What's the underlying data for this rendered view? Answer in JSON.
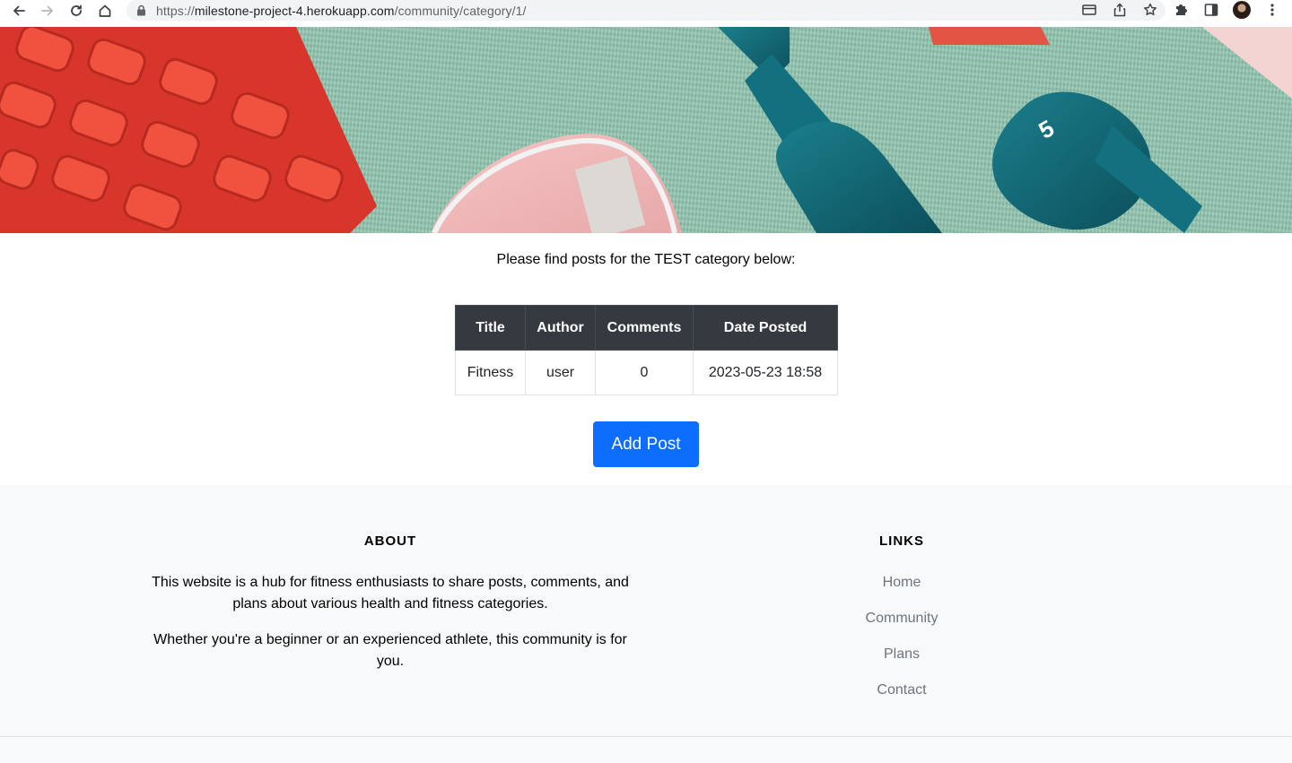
{
  "browser": {
    "url_scheme": "https://",
    "url_host": "milestone-project-4.herokuapp.com",
    "url_path": "/community/category/1/"
  },
  "hero": {
    "dumbbell_label": "5"
  },
  "intro_text": "Please find posts for the TEST category below:",
  "table": {
    "headers": [
      "Title",
      "Author",
      "Comments",
      "Date Posted"
    ],
    "rows": [
      [
        "Fitness",
        "user",
        "0",
        "2023-05-23 18:58"
      ]
    ]
  },
  "add_post_label": "Add Post",
  "footer": {
    "about_heading": "ABOUT",
    "about_p1": "This website is a hub for fitness enthusiasts to share posts, comments, and plans about various health and fitness categories.",
    "about_p2": "Whether you're a beginner or an experienced athlete, this community is for you.",
    "links_heading": "LINKS",
    "links": [
      "Home",
      "Community",
      "Plans",
      "Contact"
    ]
  },
  "colors": {
    "primary": "#0d6efd",
    "table_header": "#343a40",
    "footer_bg": "#f8f9fa",
    "link": "#6c757d"
  }
}
